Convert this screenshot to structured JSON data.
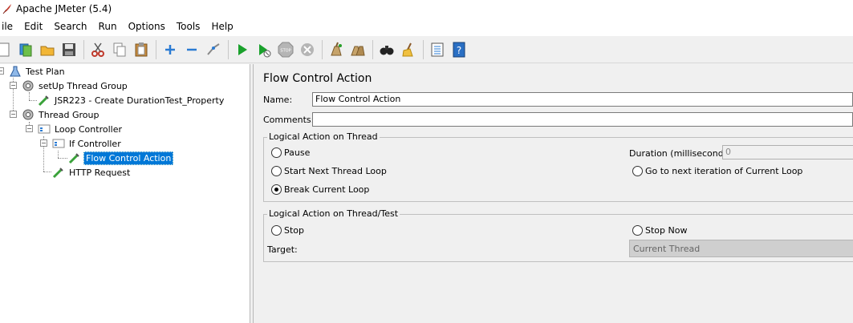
{
  "window": {
    "title": "Apache JMeter (5.4)"
  },
  "menu": {
    "items": [
      "ile",
      "Edit",
      "Search",
      "Run",
      "Options",
      "Tools",
      "Help"
    ]
  },
  "toolbar": {
    "buttons": [
      {
        "name": "new-icon"
      },
      {
        "name": "templates-icon"
      },
      {
        "name": "open-icon"
      },
      {
        "name": "save-icon"
      },
      {
        "name": "cut-icon"
      },
      {
        "name": "copy-icon"
      },
      {
        "name": "paste-icon"
      },
      {
        "name": "expand-icon"
      },
      {
        "name": "collapse-icon"
      },
      {
        "name": "toggle-icon"
      },
      {
        "name": "start-icon"
      },
      {
        "name": "start-no-pauses-icon"
      },
      {
        "name": "stop-icon"
      },
      {
        "name": "shutdown-icon"
      },
      {
        "name": "clear-icon"
      },
      {
        "name": "clear-all-icon"
      },
      {
        "name": "search-icon"
      },
      {
        "name": "reset-search-icon"
      },
      {
        "name": "function-helper-icon"
      },
      {
        "name": "help-icon"
      }
    ],
    "stop_text": "STOP"
  },
  "tree": {
    "nodes": [
      {
        "label": "Test Plan",
        "icon": "test-plan-icon"
      },
      {
        "label": "setUp Thread Group",
        "icon": "thread-group-icon"
      },
      {
        "label": "JSR223 - Create DurationTest_Property",
        "icon": "sampler-icon"
      },
      {
        "label": "Thread Group",
        "icon": "thread-group-icon"
      },
      {
        "label": "Loop Controller",
        "icon": "controller-icon"
      },
      {
        "label": "If Controller",
        "icon": "controller-icon"
      },
      {
        "label": "Flow Control Action",
        "icon": "sampler-icon",
        "selected": true
      },
      {
        "label": "HTTP Request",
        "icon": "sampler-icon"
      }
    ]
  },
  "form": {
    "title": "Flow Control Action",
    "name_label": "Name:",
    "name_value": "Flow Control Action",
    "comments_label": "Comments:",
    "comments_value": "",
    "thread_group": {
      "title": "Logical Action on Thread",
      "options": [
        {
          "label": "Pause",
          "checked": false
        },
        {
          "label": "Start Next Thread Loop",
          "checked": false
        },
        {
          "label": "Break Current Loop",
          "checked": true
        },
        {
          "label": "Go to next iteration of Current Loop",
          "checked": false
        }
      ],
      "duration_label": "Duration (milliseconds):",
      "duration_value": "0"
    },
    "test_group": {
      "title": "Logical Action on Thread/Test",
      "options": [
        {
          "label": "Stop",
          "checked": false
        },
        {
          "label": "Stop Now",
          "checked": false
        }
      ],
      "target_label": "Target:",
      "target_value": "Current Thread"
    }
  }
}
